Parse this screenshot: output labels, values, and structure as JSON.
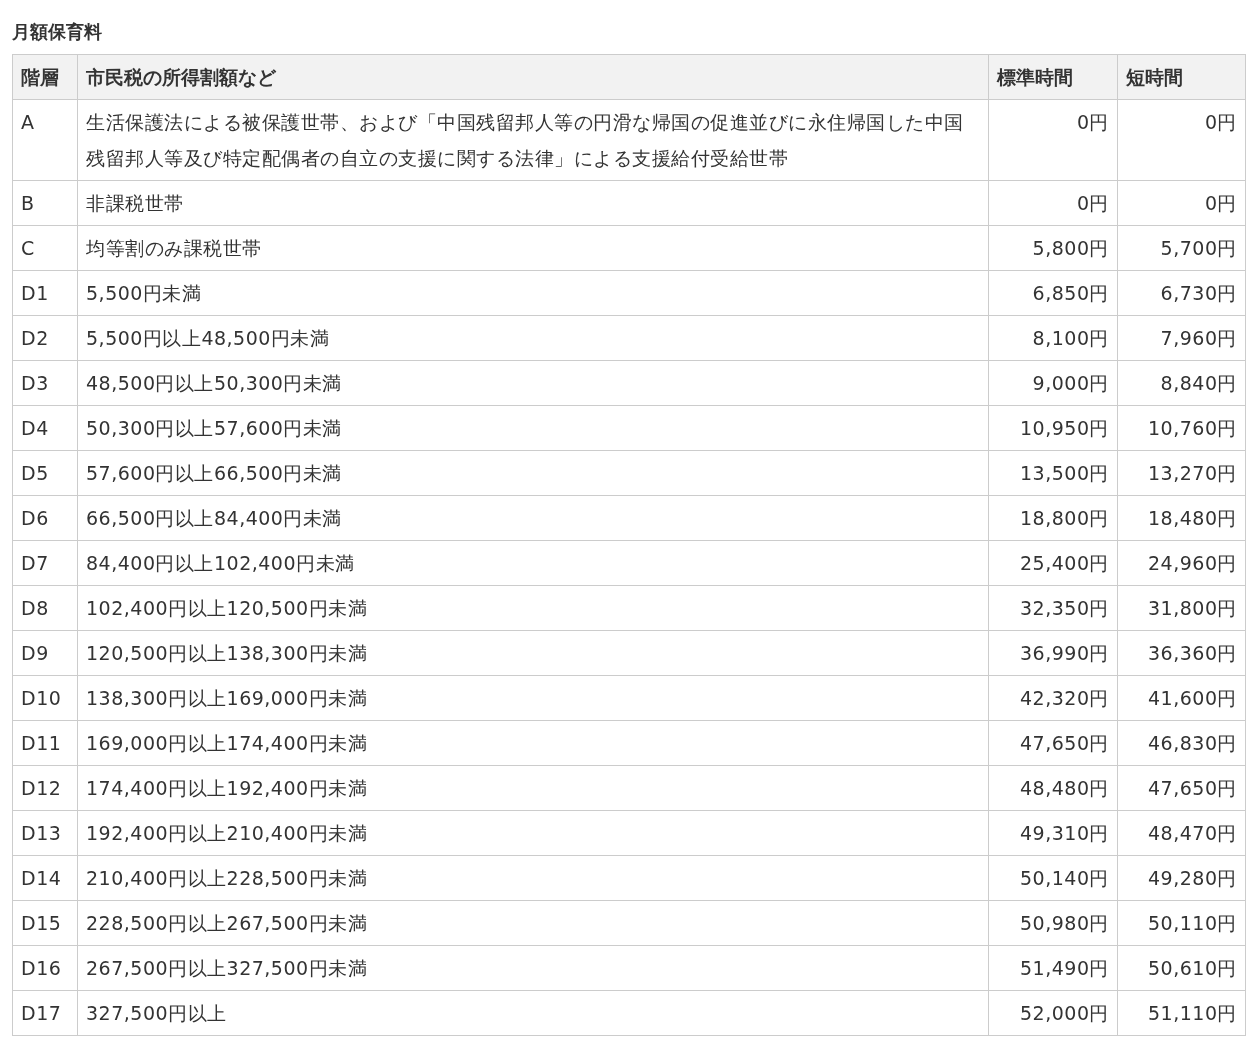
{
  "title": "月額保育料",
  "table": {
    "columns": [
      "階層",
      "市民税の所得割額など",
      "標準時間",
      "短時間"
    ],
    "rows": [
      [
        "A",
        "生活保護法による被保護世帯、および「中国残留邦人等の円滑な帰国の促進並びに永住帰国した中国残留邦人等及び特定配偶者の自立の支援に関する法律」による支援給付受給世帯",
        "0円",
        "0円"
      ],
      [
        "B",
        "非課税世帯",
        "0円",
        "0円"
      ],
      [
        "C",
        "均等割のみ課税世帯",
        "5,800円",
        "5,700円"
      ],
      [
        "D1",
        "5,500円未満",
        "6,850円",
        "6,730円"
      ],
      [
        "D2",
        "5,500円以上48,500円未満",
        "8,100円",
        "7,960円"
      ],
      [
        "D3",
        "48,500円以上50,300円未満",
        "9,000円",
        "8,840円"
      ],
      [
        "D4",
        "50,300円以上57,600円未満",
        "10,950円",
        "10,760円"
      ],
      [
        "D5",
        "57,600円以上66,500円未満",
        "13,500円",
        "13,270円"
      ],
      [
        "D6",
        "66,500円以上84,400円未満",
        "18,800円",
        "18,480円"
      ],
      [
        "D7",
        "84,400円以上102,400円未満",
        "25,400円",
        "24,960円"
      ],
      [
        "D8",
        "102,400円以上120,500円未満",
        "32,350円",
        "31,800円"
      ],
      [
        "D9",
        "120,500円以上138,300円未満",
        "36,990円",
        "36,360円"
      ],
      [
        "D10",
        "138,300円以上169,000円未満",
        "42,320円",
        "41,600円"
      ],
      [
        "D11",
        "169,000円以上174,400円未満",
        "47,650円",
        "46,830円"
      ],
      [
        "D12",
        "174,400円以上192,400円未満",
        "48,480円",
        "47,650円"
      ],
      [
        "D13",
        "192,400円以上210,400円未満",
        "49,310円",
        "48,470円"
      ],
      [
        "D14",
        "210,400円以上228,500円未満",
        "50,140円",
        "49,280円"
      ],
      [
        "D15",
        "228,500円以上267,500円未満",
        "50,980円",
        "50,110円"
      ],
      [
        "D16",
        "267,500円以上327,500円未満",
        "51,490円",
        "50,610円"
      ],
      [
        "D17",
        "327,500円以上",
        "52,000円",
        "51,110円"
      ]
    ]
  }
}
